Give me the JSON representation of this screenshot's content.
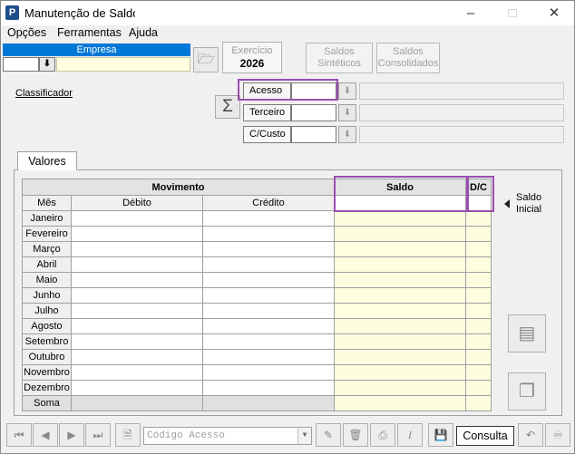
{
  "window": {
    "title": "Manutenção de Saldos",
    "icon": "P"
  },
  "menu": [
    "Opções",
    "Ferramentas",
    "Ajuda"
  ],
  "empresa": {
    "label": "Empresa",
    "code": "",
    "name": ""
  },
  "exercicio": {
    "label": "Exercício",
    "value": "2026"
  },
  "buttons": {
    "sinteticos": [
      "Saldos",
      "Sintéticos"
    ],
    "consolidados": [
      "Saldos",
      "Consolidados"
    ]
  },
  "classificador": "Classificador",
  "fields": {
    "acesso": "Acesso",
    "terceiro": "Terceiro",
    "custo": "C/Custo"
  },
  "tab": "Valores",
  "table": {
    "movimento": "Movimento",
    "saldo": "Saldo",
    "dc": "D/C",
    "mes": "Mês",
    "debito": "Débito",
    "credito": "Crédito",
    "months": [
      "Janeiro",
      "Fevereiro",
      "Março",
      "Abril",
      "Maio",
      "Junho",
      "Julho",
      "Agosto",
      "Setembro",
      "Outubro",
      "Novembro",
      "Dezembro"
    ],
    "soma": "Soma"
  },
  "saldo_inicial": [
    "Saldo",
    "Inicial"
  ],
  "bottom": {
    "codigo_placeholder": "Código Acesso",
    "mode": "Consulta"
  },
  "colors": {
    "highlight": "#9a4fb0",
    "accent": "#0078d7",
    "yellow_cell": "#fdfde0"
  }
}
